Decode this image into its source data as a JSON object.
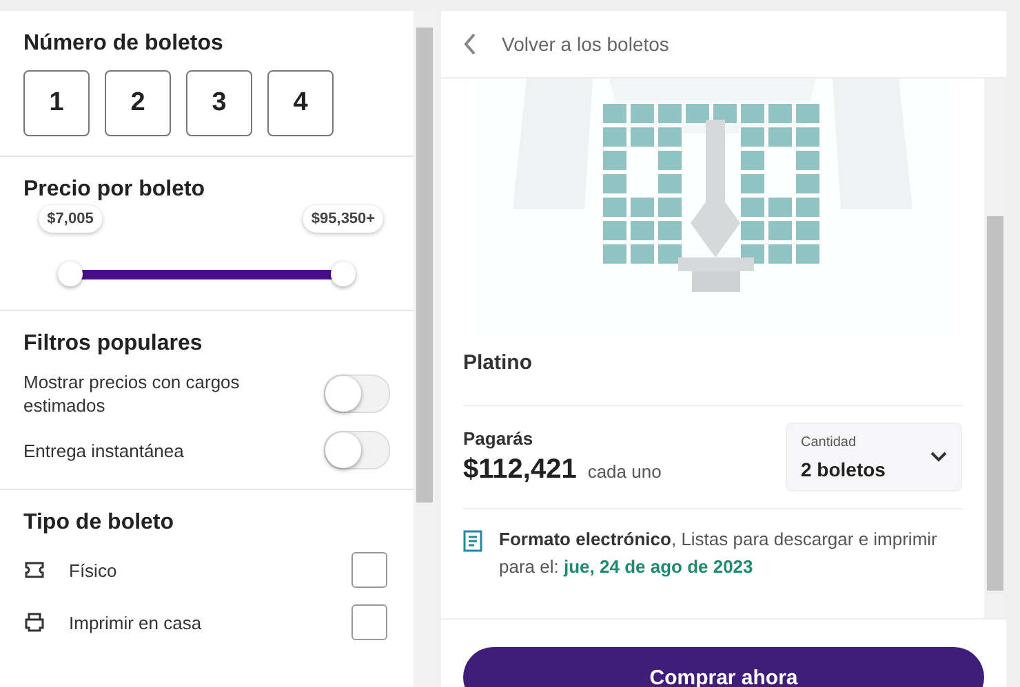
{
  "ticket_count": {
    "title": "Número de boletos",
    "options": [
      {
        "label": "1",
        "selected": false
      },
      {
        "label": "2",
        "selected": false
      },
      {
        "label": "3",
        "selected": false
      },
      {
        "label": "4",
        "selected": false
      }
    ]
  },
  "price": {
    "title": "Precio por boleto",
    "thumbs": [
      {
        "label": "$7,005",
        "level": 0
      },
      {
        "label": "$95,350+",
        "level": 1
      }
    ]
  },
  "popular_filters": {
    "title": "Filtros populares",
    "toggles": [
      {
        "label": "Mostrar precios con cargos estimados",
        "on": false
      },
      {
        "label": "Entrega instantánea",
        "on": false
      }
    ]
  },
  "ticket_type": {
    "title": "Tipo de boleto",
    "options": [
      {
        "label": "Físico",
        "kind": "ticket",
        "checked": false
      },
      {
        "label": "Imprimir en casa",
        "kind": "printer",
        "checked": false
      }
    ]
  },
  "detail": {
    "back_label": "Volver a los boletos",
    "section": "Platino",
    "pay_label": "Pagarás",
    "price": "$112,421",
    "price_unit": "cada uno",
    "quantity": {
      "label": "Cantidad",
      "value": "2 boletos"
    },
    "delivery": "**Formato electrónico**, Listas para descargar e imprimir para el: **jue, 24 de ago de 2023**",
    "buy_button": "Comprar ahora"
  }
}
